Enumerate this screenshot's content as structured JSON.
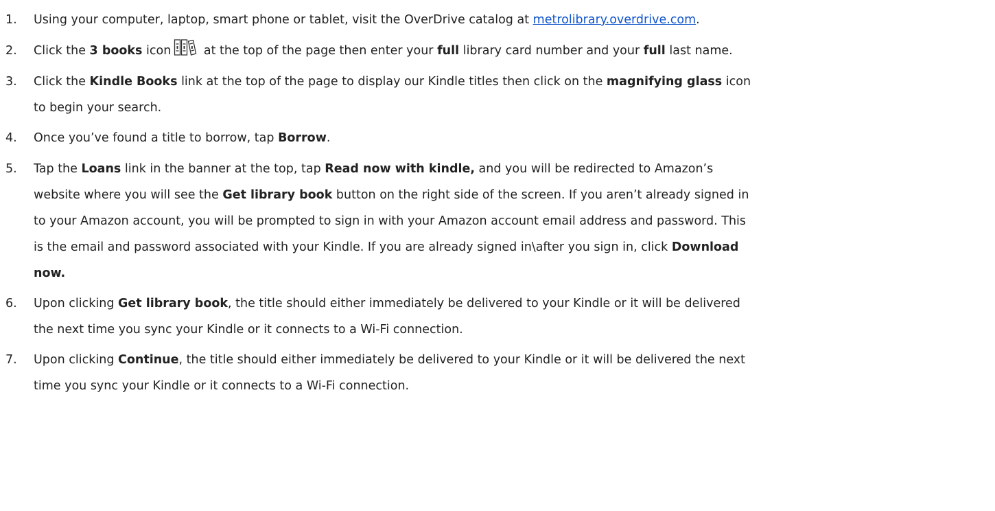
{
  "steps": [
    {
      "number": "1.",
      "text_before": "Using your computer, laptop, smart phone or tablet, visit the OverDrive catalog at ",
      "link": "metrolibrary.overdrive.com",
      "text_after": "."
    },
    {
      "number": "2.",
      "t1": "Click the ",
      "b1": "3 books",
      "t2": " icon",
      "icon": "three-books-icon",
      "t3": " at the top of the page then enter your ",
      "b2": "full",
      "t4": " library card number and your ",
      "b3": "full",
      "t5": " last name."
    },
    {
      "number": "3.",
      "t1": "Click the ",
      "b1": "Kindle Books",
      "t2": " link at the top of the page to display our Kindle titles then click on the ",
      "b2": "magnifying glass",
      "t3": " icon",
      "line2": "to begin your search."
    },
    {
      "number": "4.",
      "t1": "Once you’ve found a title to borrow, tap ",
      "b1": "Borrow",
      "t2": "."
    },
    {
      "number": "5.",
      "t1": "Tap the ",
      "b1": "Loans",
      "t2": " link in the banner at the top, tap ",
      "b2": "Read now with kindle,",
      "t3": " and you will be redirected to Amazon’s",
      "l2a": "website where you will see the ",
      "l2b": "Get library book",
      "l2c": " button on the right side of the screen. If you aren’t already signed in",
      "line3": "to your Amazon account, you will be prompted to sign in with your Amazon account email address and password. This",
      "l4a": "is the email and password associated with your Kindle. If you are already signed in\\after you sign in, click ",
      "l4b": "Download",
      "l5": "now."
    },
    {
      "number": "6.",
      "t1": "Upon clicking ",
      "b1": "Get library book",
      "t2": ", the title should either immediately be delivered to your Kindle or it will be delivered",
      "line2": "the next time you sync your Kindle or it connects to a Wi-Fi connection."
    },
    {
      "number": "7.",
      "t1": "Upon clicking ",
      "b1": "Continue",
      "t2": ", the title should either immediately be delivered to your Kindle or it will be delivered the next",
      "line2": "time you sync your Kindle or it connects to a Wi-Fi connection."
    }
  ],
  "colors": {
    "text": "#222222",
    "link": "#1155cc"
  }
}
